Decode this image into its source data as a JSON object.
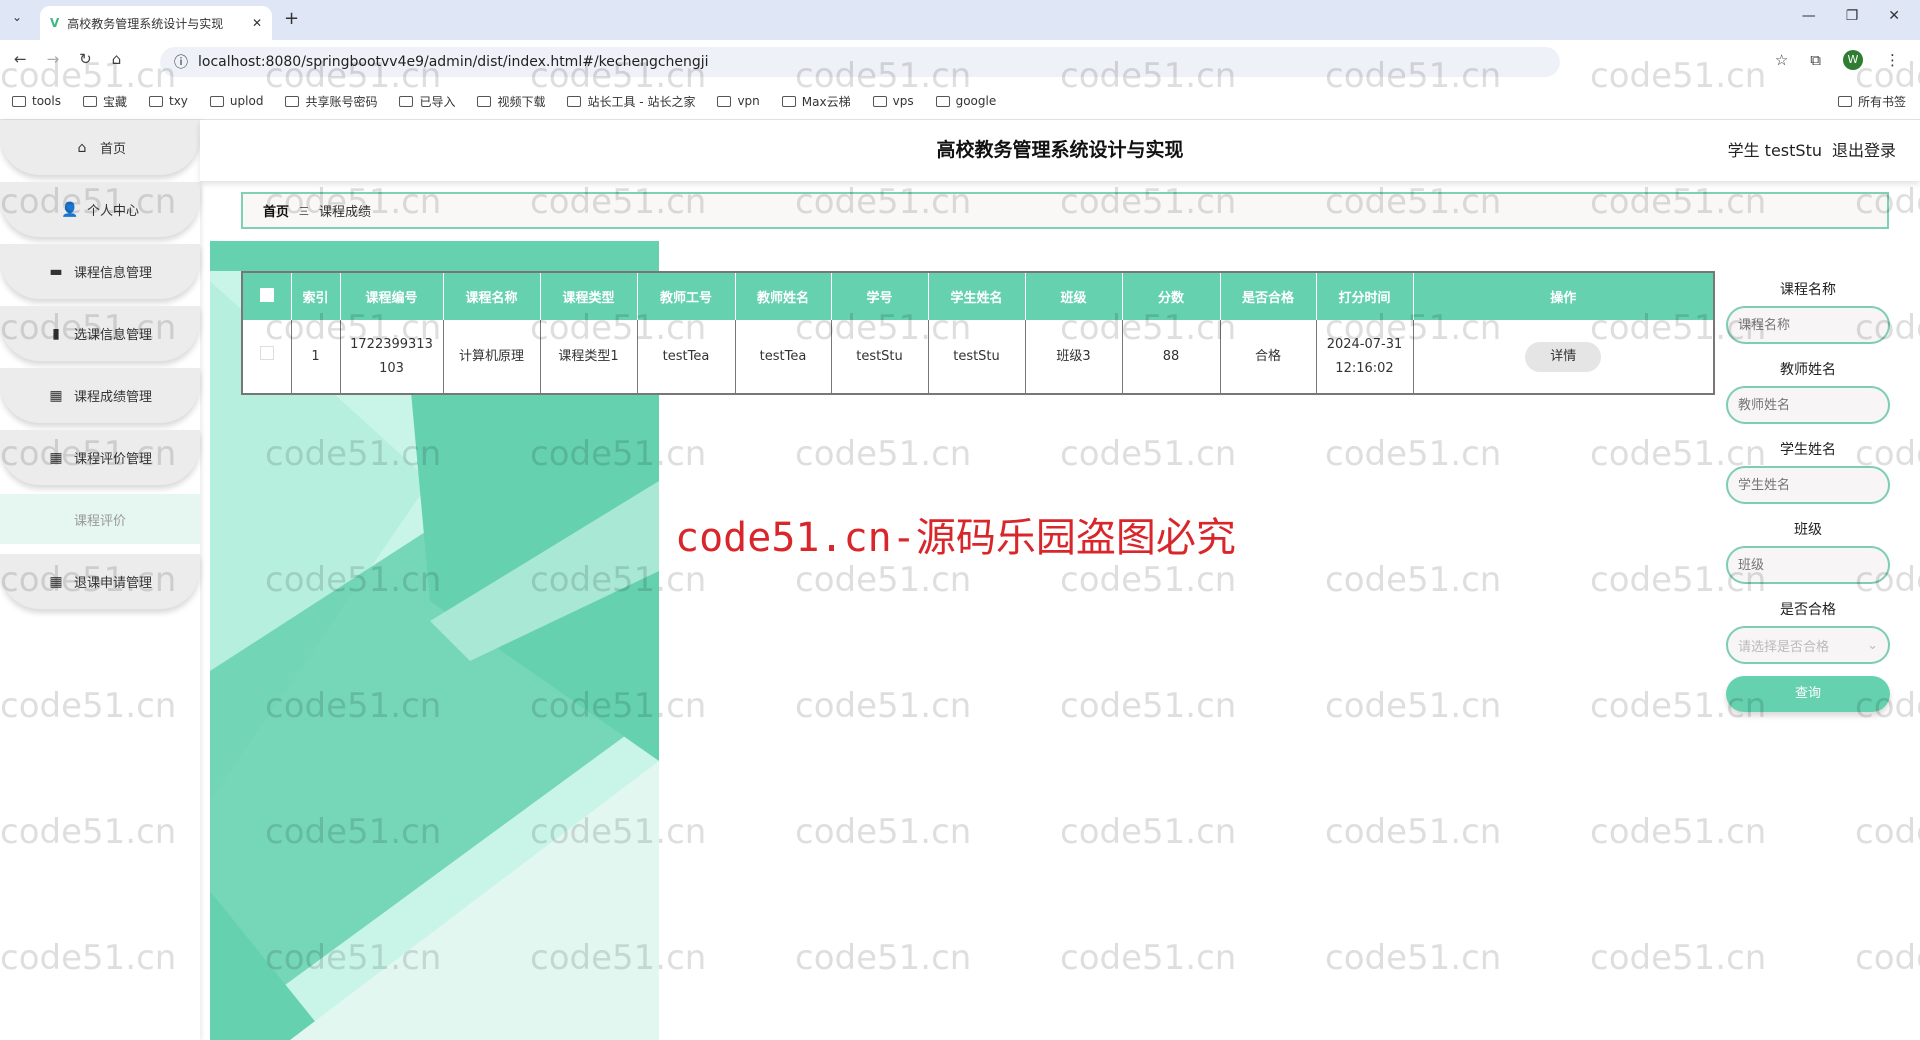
{
  "browser": {
    "tab_title": "高校教务管理系统设计与实现",
    "url": "localhost:8080/springbootvv4e9/admin/dist/index.html#/kechengchengji",
    "bookmarks": [
      "tools",
      "宝藏",
      "txy",
      "uplod",
      "共享账号密码",
      "已导入",
      "视频下载",
      "站长工具 - 站长之家",
      "vpn",
      "Max云梯",
      "vps",
      "google"
    ],
    "all_bookmarks": "所有书签",
    "profile": "W"
  },
  "header": {
    "title": "高校教务管理系统设计与实现",
    "user": "学生 testStu",
    "logout": "退出登录"
  },
  "sidebar": {
    "items": [
      {
        "label": "首页",
        "icon": "home-icon"
      },
      {
        "label": "个人中心",
        "icon": "user-icon"
      },
      {
        "label": "课程信息管理",
        "icon": "briefcase-icon"
      },
      {
        "label": "选课信息管理",
        "icon": "chart-icon"
      },
      {
        "label": "课程成绩管理",
        "icon": "grid-icon"
      },
      {
        "label": "课程评价管理",
        "icon": "grid-icon"
      },
      {
        "label": "课程评价",
        "icon": "",
        "sub": true
      },
      {
        "label": "退课申请管理",
        "icon": "grid-icon"
      }
    ]
  },
  "breadcrumb": {
    "home": "首页",
    "sep": "三",
    "current": "课程成绩"
  },
  "table": {
    "columns": [
      "索引",
      "课程编号",
      "课程名称",
      "课程类型",
      "教师工号",
      "教师姓名",
      "学号",
      "学生姓名",
      "班级",
      "分数",
      "是否合格",
      "打分时间",
      "操作"
    ],
    "rows": [
      {
        "index": "1",
        "course_no_1": "1722399313",
        "course_no_2": "103",
        "course_name": "计算机原理",
        "course_type": "课程类型1",
        "teacher_no": "testTea",
        "teacher_name": "testTea",
        "student_no": "testStu",
        "student_name": "testStu",
        "class": "班级3",
        "score": "88",
        "passed": "合格",
        "date": "2024-07-31",
        "time": "12:16:02",
        "action": "详情"
      }
    ]
  },
  "search": {
    "fields": [
      {
        "label": "课程名称",
        "placeholder": "课程名称"
      },
      {
        "label": "教师姓名",
        "placeholder": "教师姓名"
      },
      {
        "label": "学生姓名",
        "placeholder": "学生姓名"
      },
      {
        "label": "班级",
        "placeholder": "班级"
      }
    ],
    "pass_label": "是否合格",
    "pass_placeholder": "请选择是否合格",
    "query": "查询"
  },
  "watermark": "code51.cn",
  "red_watermark": "code51.cn-源码乐园盗图必究",
  "colors": {
    "accent": "#66d1af",
    "border": "#7fcdb0",
    "red": "#d9262b"
  }
}
